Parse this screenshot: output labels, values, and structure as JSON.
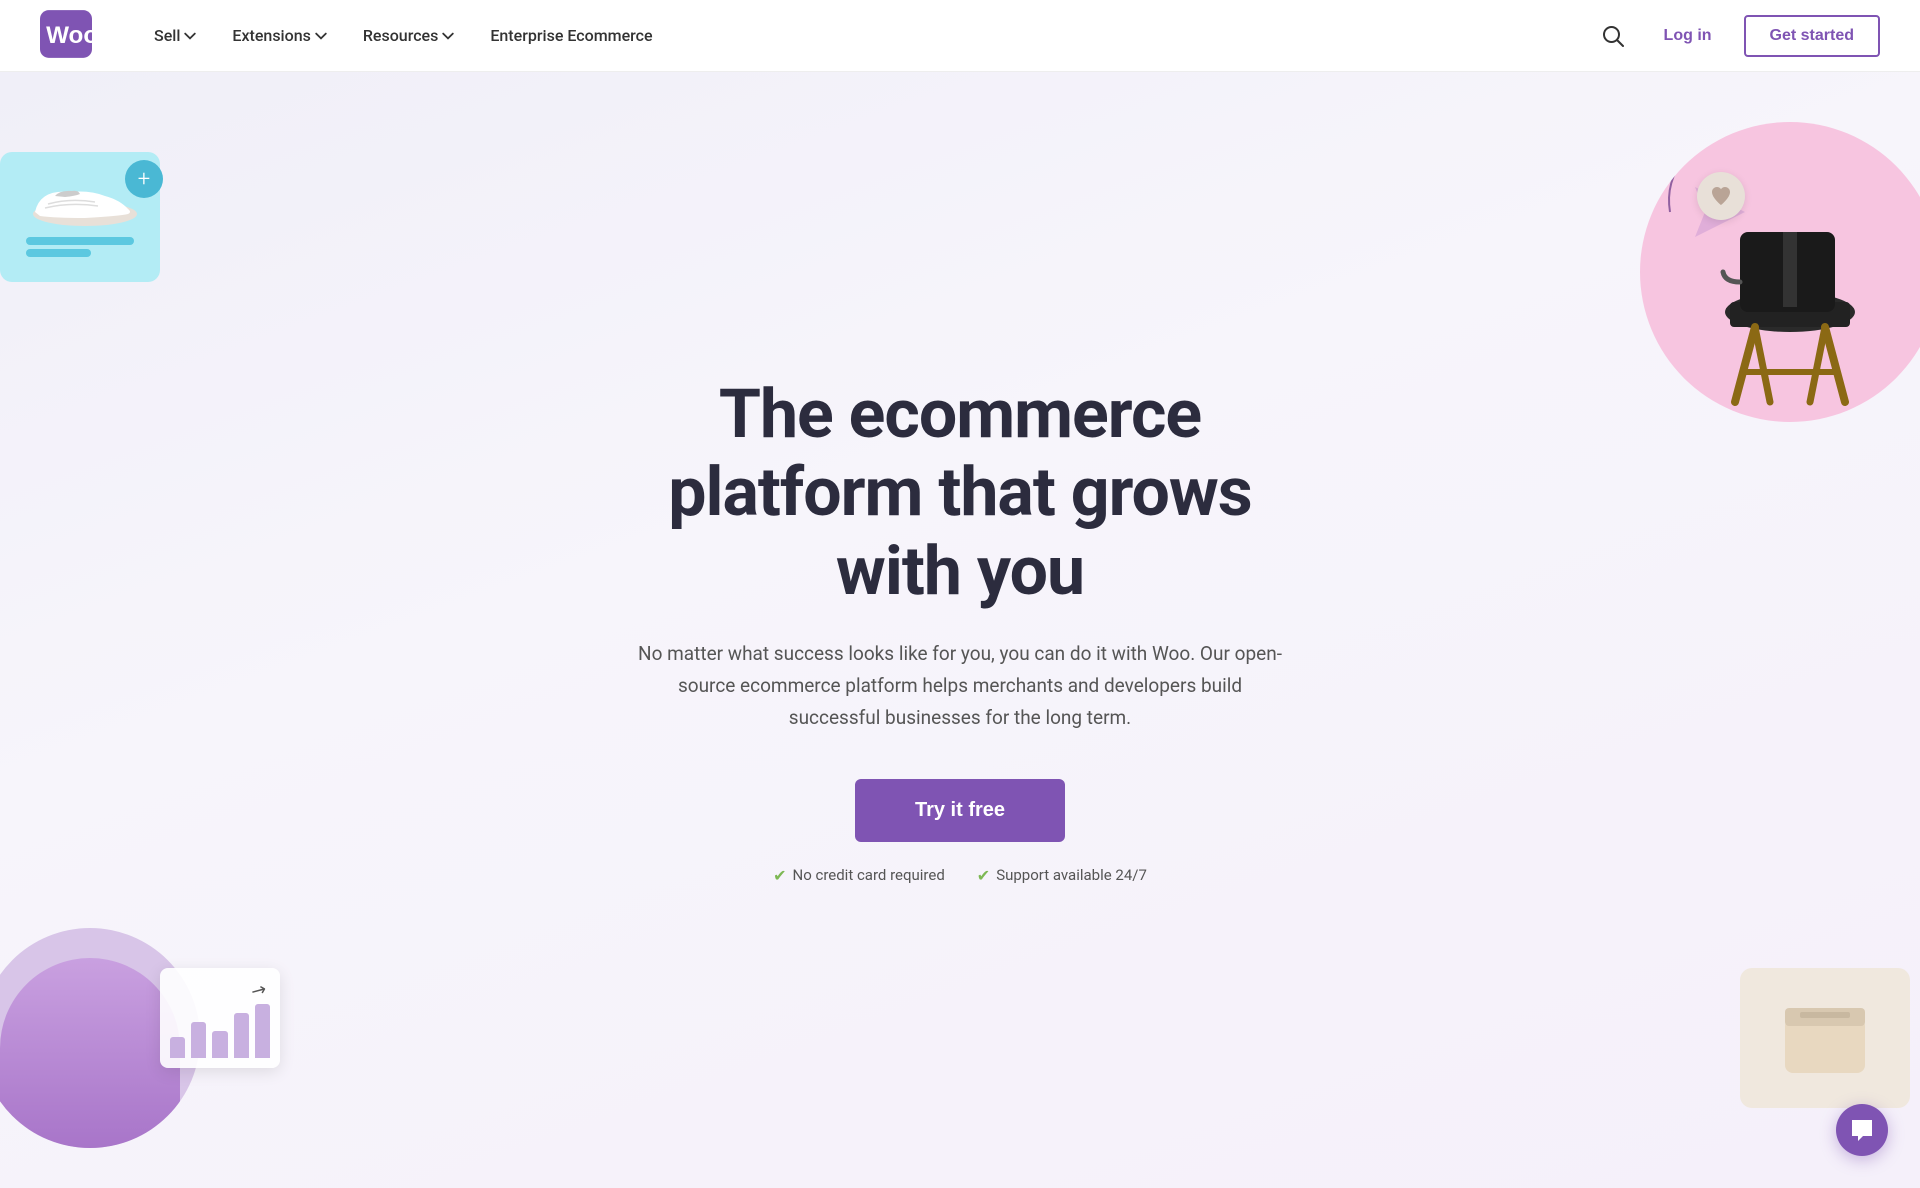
{
  "nav": {
    "logo_alt": "WooCommerce",
    "items": [
      {
        "label": "Sell",
        "has_dropdown": true
      },
      {
        "label": "Extensions",
        "has_dropdown": true
      },
      {
        "label": "Resources",
        "has_dropdown": true
      },
      {
        "label": "Enterprise Ecommerce",
        "has_dropdown": false
      }
    ],
    "search_aria": "Search",
    "login_label": "Log in",
    "get_started_label": "Get started"
  },
  "hero": {
    "title_line1": "The ecommerce",
    "title_line2": "platform that grows",
    "title_line3": "with you",
    "subtitle": "No matter what success looks like for you, you can do it with Woo. Our open-source ecommerce platform helps merchants and developers build successful businesses for the long term.",
    "cta_label": "Try it free",
    "trust1": "No credit card required",
    "trust2": "Support available 24/7"
  },
  "chat": {
    "aria": "Open chat"
  },
  "colors": {
    "brand_purple": "#7f54b3",
    "brand_purple_dark": "#6d44a0",
    "accent_teal": "#4ab8d4",
    "accent_pink": "#f7c5e0",
    "accent_lilac": "#d8c5e8",
    "check_green": "#7db854"
  },
  "chart": {
    "bars": [
      30,
      55,
      40,
      70,
      85
    ]
  }
}
